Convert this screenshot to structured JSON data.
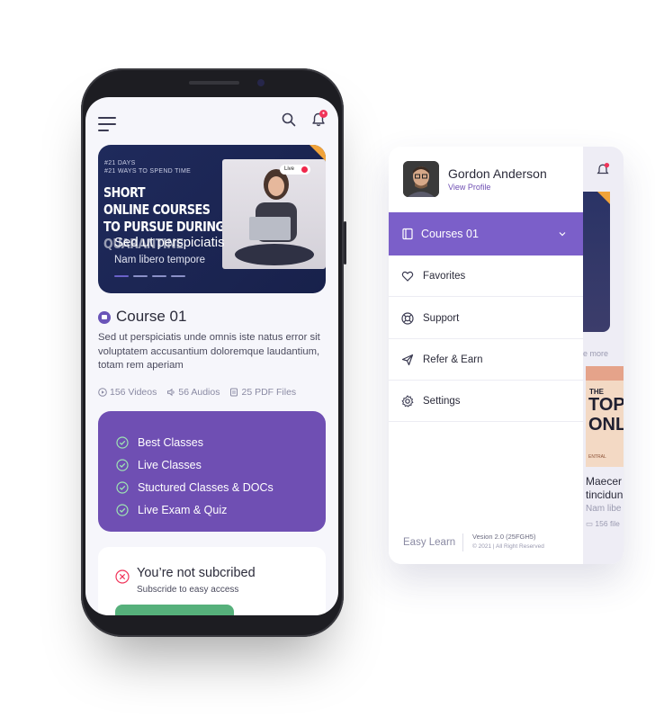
{
  "phone": {
    "banner": {
      "tag1": "#21 DAYS",
      "tag2": "#21 WAYS TO SPEND TIME",
      "headline": [
        "SHORT",
        "ONLINE COURSES",
        "TO PURSUE DURING",
        "QUARANTINE"
      ],
      "live": "Live",
      "title": "Sed ut perspiciatis",
      "subtitle": "Nam libero tempore"
    },
    "course": {
      "title": "Course 01",
      "description": "Sed ut perspiciatis unde omnis iste natus error sit voluptatem accusantium doloremque laudantium, totam rem aperiam",
      "stats": [
        {
          "icon": "play-icon",
          "label": "156 Videos"
        },
        {
          "icon": "audio-icon",
          "label": "56 Audios"
        },
        {
          "icon": "pdf-icon",
          "label": "25 PDF Files"
        }
      ]
    },
    "features": [
      "Best Classes",
      "Live Classes",
      "Stuctured Classes & DOCs",
      "Live Exam & Quiz"
    ],
    "subscription": {
      "heading": "You’re not subcribed",
      "text": "Subscride to easy access"
    },
    "colors": {
      "accent": "#6f4fb3",
      "banner": "#1f2a5c",
      "badge": "#f0345a",
      "cta": "#56b07b"
    }
  },
  "drawer": {
    "profile": {
      "name": "Gordon Anderson",
      "link": "View Profile"
    },
    "active_item": "Courses 01",
    "items": [
      {
        "label": "Favorites",
        "icon": "heart-icon"
      },
      {
        "label": "Support",
        "icon": "lifebuoy-icon"
      },
      {
        "label": "Refer & Earn",
        "icon": "send-icon"
      },
      {
        "label": "Settings",
        "icon": "gear-icon"
      }
    ],
    "footer": {
      "brand": "Easy Learn",
      "version": "Vesion 2.0 (25FGH5)",
      "copyright": "© 2021 | All Right Reserved"
    }
  },
  "background_screen": {
    "see_more": "e more",
    "promo_small": "THE",
    "promo_large": [
      "TOP",
      "ONL"
    ],
    "promo_footer": "ENTRAL",
    "title_line1": "Maecer",
    "title_line2": "tincidun",
    "subtitle": "Nam libe",
    "files": "156 file"
  }
}
